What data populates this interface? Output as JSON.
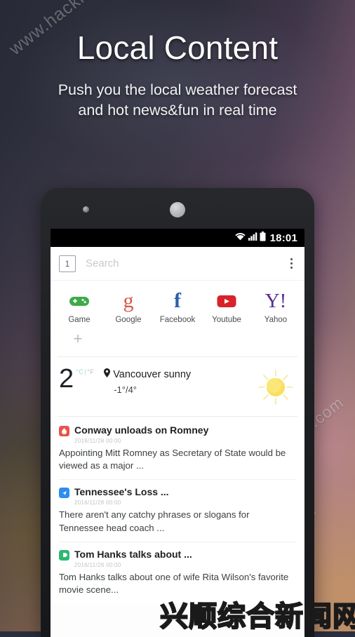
{
  "promo": {
    "headline": "Local Content",
    "subline_line1": "Push you the local weather forecast",
    "subline_line2": "and hot news&fun in real time"
  },
  "watermarks": {
    "site": "www.hackhome.com",
    "site_b": "www.hackhome.com",
    "site_c": "www.hackhome.com",
    "chinese": "兴顺综合新闻网"
  },
  "phone": {
    "statusbar": {
      "wifi_icon": "wifi-icon",
      "signal_icon": "signal-icon",
      "battery_icon": "battery-icon",
      "time": "18:01"
    },
    "search": {
      "tab_count": "1",
      "placeholder": "Search",
      "menu_icon": "overflow-menu-icon"
    },
    "shortcuts": [
      {
        "label": "Game",
        "icon": "gamepad-icon",
        "color": "#3faa4a"
      },
      {
        "label": "Google",
        "icon": "google-g-icon",
        "color": "#d9584a"
      },
      {
        "label": "Facebook",
        "icon": "facebook-f-icon",
        "color": "#2d5fa8"
      },
      {
        "label": "Youtube",
        "icon": "youtube-icon",
        "color": "#d8232a"
      },
      {
        "label": "Yahoo",
        "icon": "yahoo-icon",
        "color": "#5b2d90"
      }
    ],
    "add_shortcut_label": "+",
    "weather": {
      "temperature": "2",
      "unit_celsius": "°C",
      "unit_separator": "|",
      "unit_fahrenheit": "°F",
      "location_icon": "location-pin-icon",
      "location": "Vancouver sunny",
      "range": "-1°/4°",
      "condition_icon": "sun-icon"
    },
    "news": [
      {
        "source_icon": "news-source-icon-red",
        "source_color": "#e8544a",
        "title": "Conway unloads on Romney",
        "time": "2016/11/28 00:00",
        "summary": "Appointing Mitt Romney as Secretary of State would be viewed as a major ..."
      },
      {
        "source_icon": "news-source-icon-blue",
        "source_color": "#2d8cf0",
        "title": "Tennessee's Loss ...",
        "time": "2016/11/28 00:00",
        "summary": "There aren't any catchy phrases or slogans for Tennessee head coach ..."
      },
      {
        "source_icon": "news-source-icon-green",
        "source_color": "#2eb872",
        "title": "Tom Hanks talks about ...",
        "time": "2016/11/28 00:00",
        "summary": "Tom Hanks talks about one of wife Rita Wilson's favorite movie scene..."
      }
    ]
  }
}
